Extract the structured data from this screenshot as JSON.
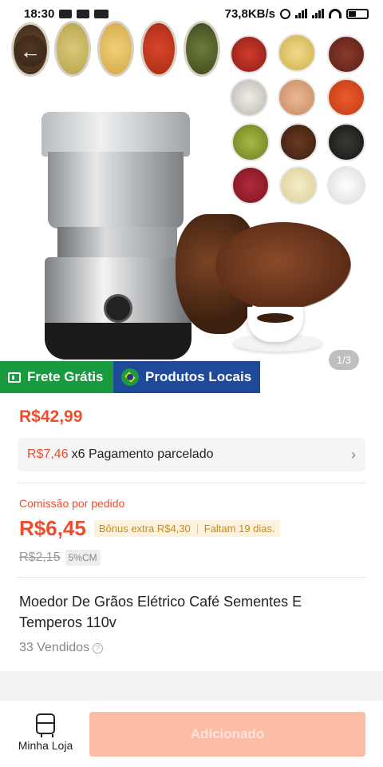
{
  "status_bar": {
    "time": "18:30",
    "net_speed": "73,8KB/s"
  },
  "hero": {
    "image_counter": "1/3",
    "image_description_icons": [
      "spice-bowl",
      "grinder",
      "coffee-beans",
      "coffee-cup"
    ]
  },
  "badges": {
    "shipping": "Frete Grátis",
    "local": "Produtos Locais"
  },
  "product": {
    "price": "R$42,99",
    "installment_amount": "R$7,46",
    "installment_text": "x6 Pagamento parcelado",
    "commission_label": "Comissão por pedido",
    "commission_value": "R$6,45",
    "bonus_text": "Bônus extra R$4,30",
    "bonus_days": "Faltam 19 dias.",
    "old_commission": "R$2,15",
    "cm_badge": "5%CM",
    "title": "Moedor De Grãos Elétrico Café Sementes E Temperos 110v",
    "sold": "33 Vendidos"
  },
  "bottom_bar": {
    "store_label": "Minha Loja",
    "add_label": "Adicionado"
  },
  "colors": {
    "accent": "#ee4d2d",
    "green_badge": "#1a9a3e",
    "blue_badge": "#1f4a9a",
    "disabled_button": "#fbbda6"
  }
}
